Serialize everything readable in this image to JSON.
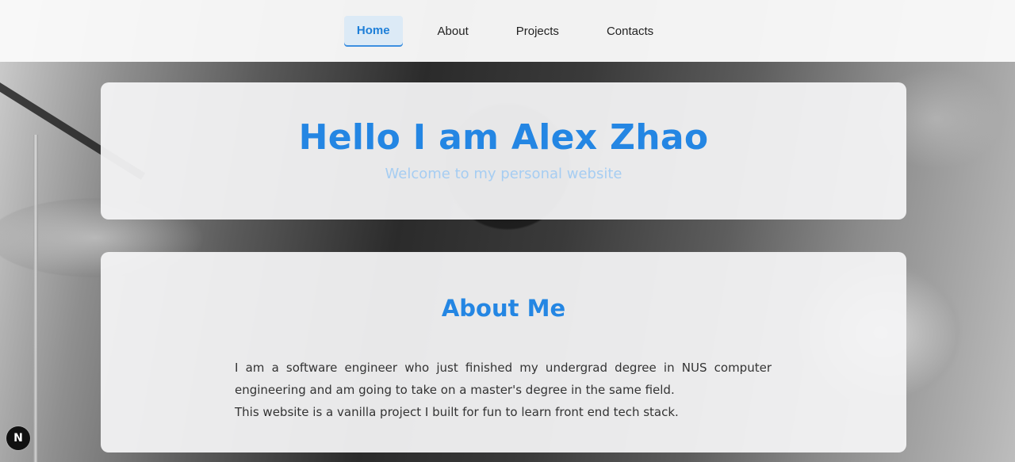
{
  "nav": {
    "items": [
      {
        "label": "Home"
      },
      {
        "label": "About"
      },
      {
        "label": "Projects"
      },
      {
        "label": "Contacts"
      }
    ]
  },
  "hero": {
    "title": "Hello I am Alex Zhao",
    "subtitle": "Welcome to my personal website"
  },
  "about": {
    "title": "About Me",
    "paragraphs": [
      "I am a software engineer who just finished my undergrad degree in NUS computer engineering and am going to take on a master's degree in the same field.",
      "This website is a vanilla project I built for fun to learn front end tech stack."
    ]
  },
  "badge": {
    "label": "N"
  },
  "colors": {
    "accent": "#2486e3",
    "subtitle": "#a6cdf2",
    "nav_active_bg": "#dceaf6"
  }
}
